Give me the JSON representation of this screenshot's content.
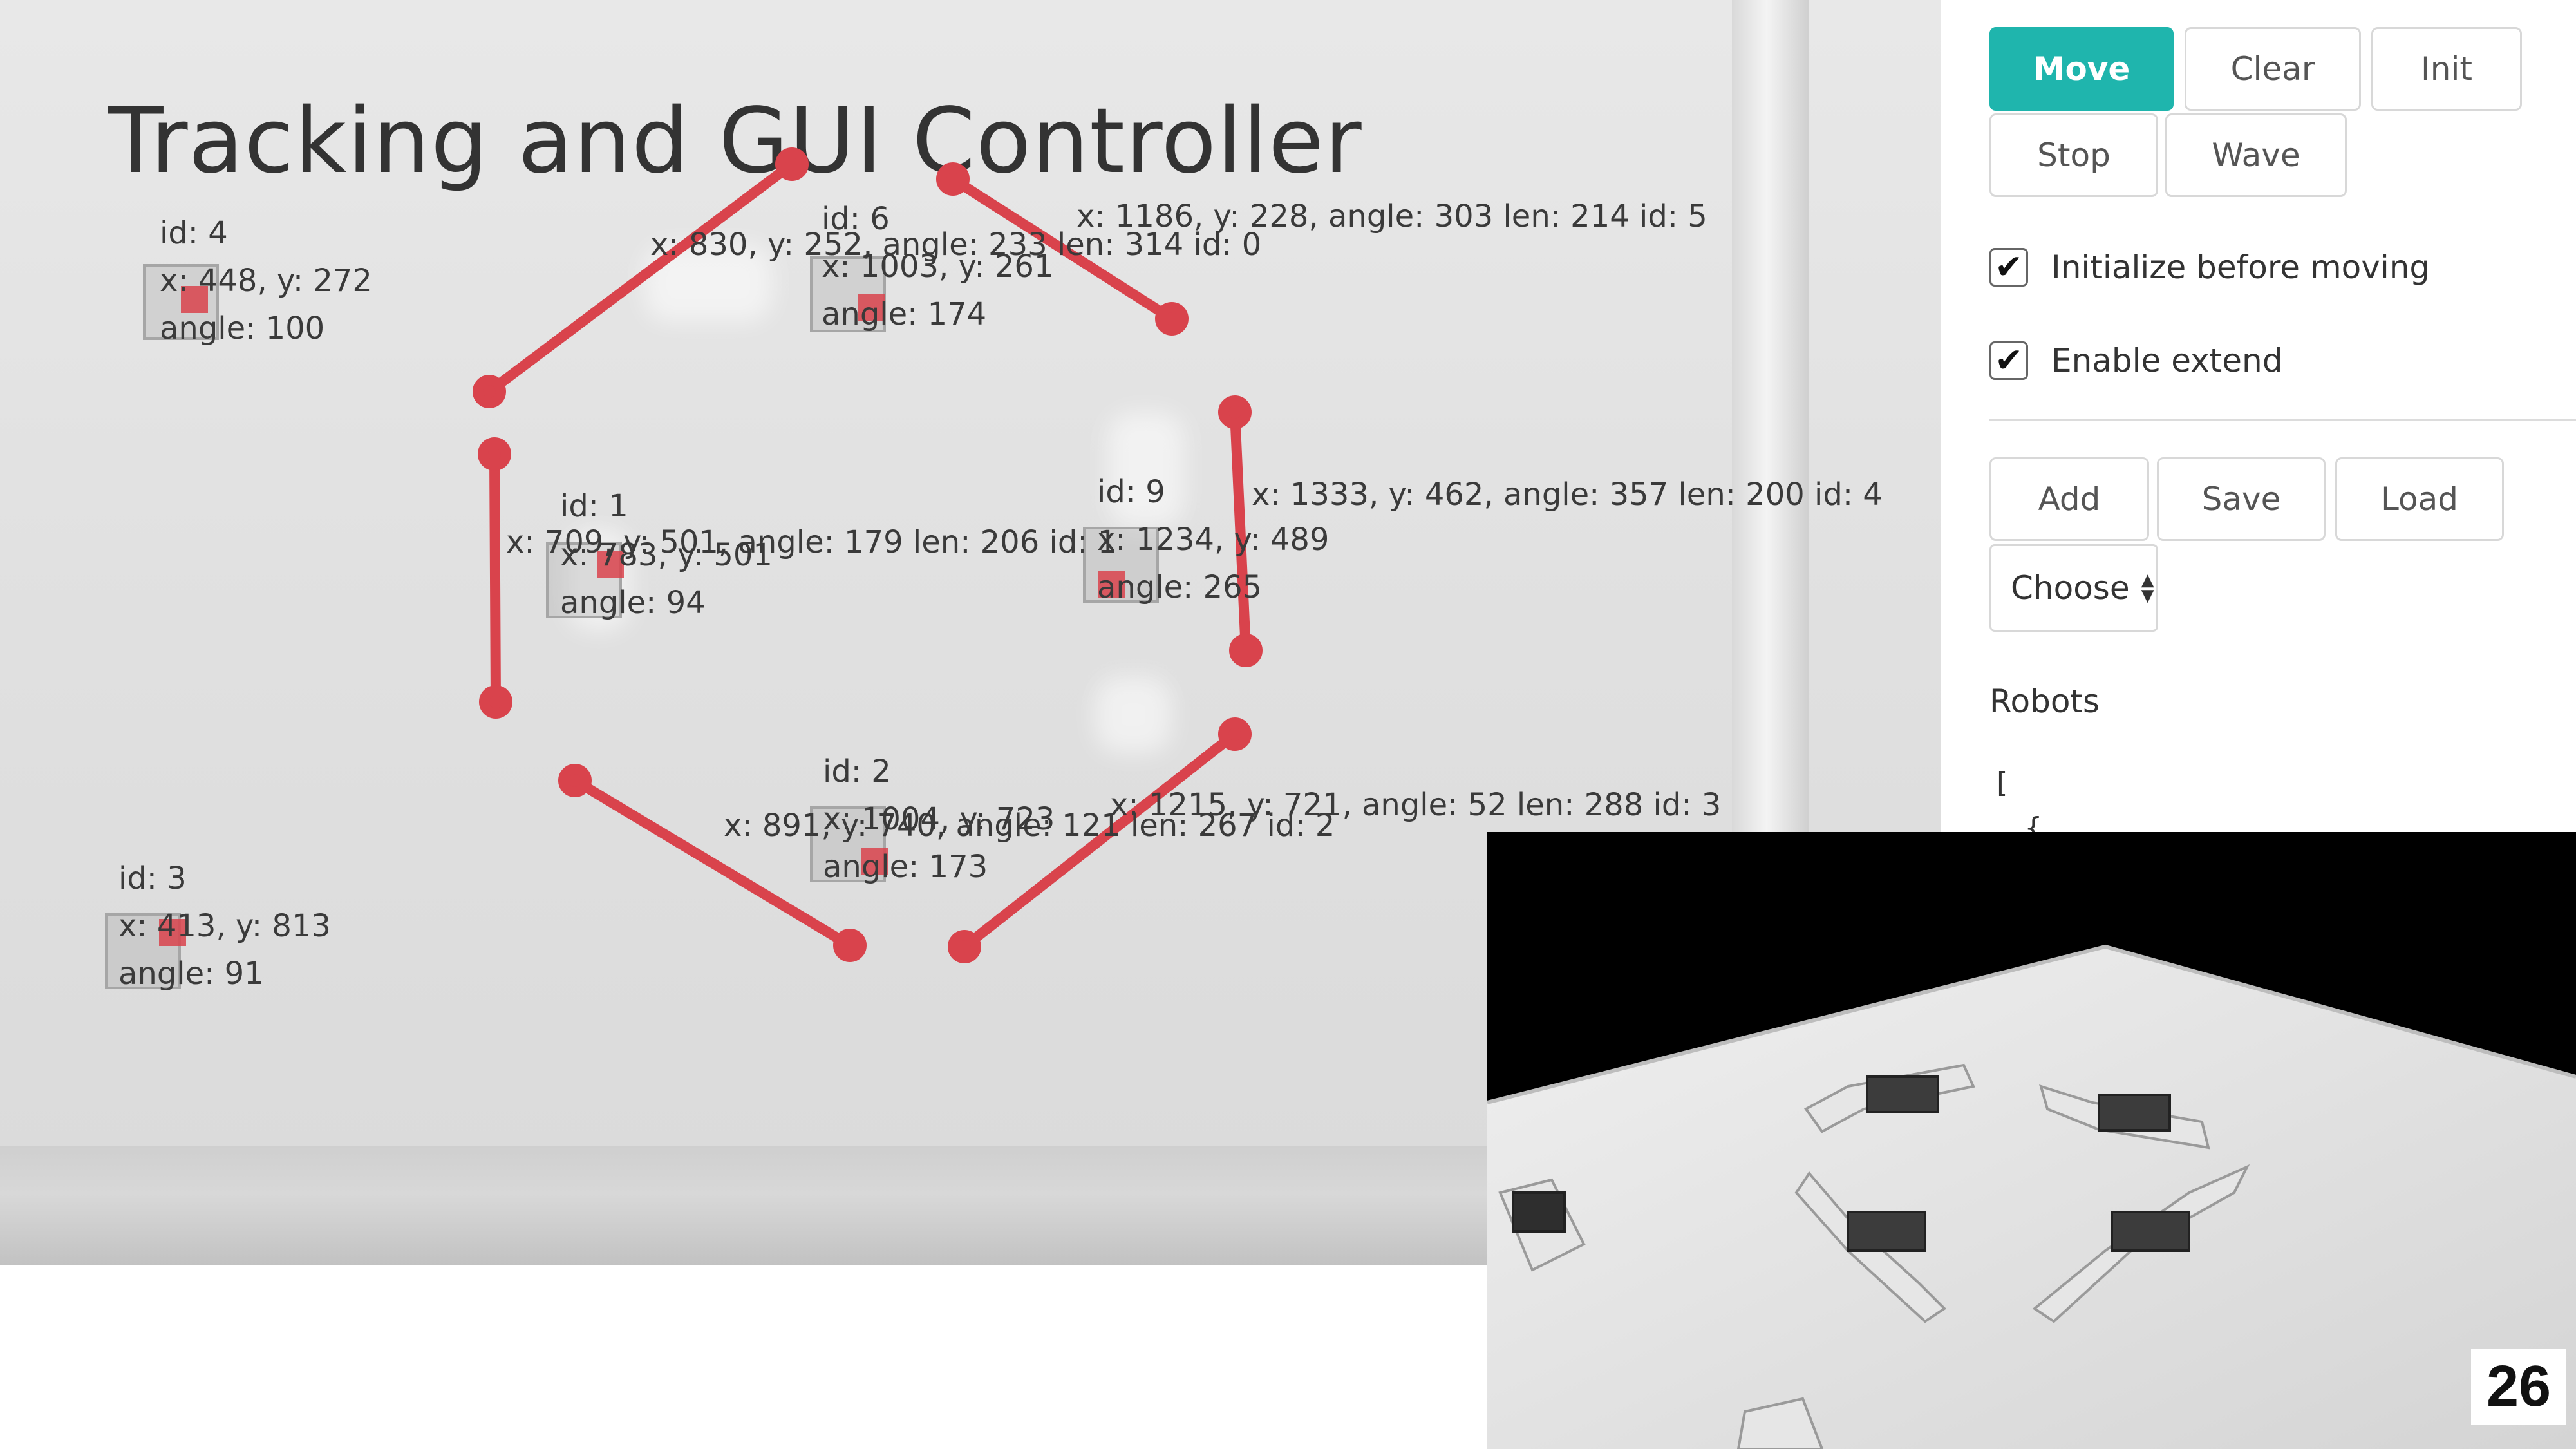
{
  "title": "Tracking and GUI Controller",
  "controls": {
    "move": "Move",
    "clear": "Clear",
    "init": "Init",
    "stop": "Stop",
    "wave": "Wave",
    "add": "Add",
    "save": "Save",
    "load": "Load",
    "choose": "Choose"
  },
  "options": {
    "init_before_moving": {
      "label": "Initialize before moving",
      "checked": true
    },
    "enable_extend": {
      "label": "Enable extend",
      "checked": true
    }
  },
  "robots_section": {
    "heading": "Robots",
    "json_line_1": "[",
    "json_line_2": "{"
  },
  "robot_markers": [
    {
      "id_label": "id: 4",
      "position": "x: 448, y: 272",
      "angle": "angle: 100"
    },
    {
      "id_label": "id: 6",
      "position": "x: 1003, y: 261",
      "angle": "angle: 174"
    },
    {
      "id_label": "id: 1",
      "position": "x: 783, y: 501",
      "angle": "angle: 94"
    },
    {
      "id_label": "id: 9",
      "position": "x: 1234, y: 489",
      "angle": "angle: 265"
    },
    {
      "id_label": "id: 2",
      "position": "x: 1004, y: 723",
      "angle": "angle: 173"
    },
    {
      "id_label": "id: 3",
      "position": "x: 413, y: 813",
      "angle": "angle: 91"
    }
  ],
  "segment_labels": [
    "x: 830, y: 252, angle: 233 len: 314 id: 0",
    "x: 1186, y: 228, angle: 303 len: 214 id: 5",
    "x: 709, y: 501, angle: 179 len: 206 id: 1",
    "x: 1333, y: 462, angle: 357 len: 200 id: 4",
    "x: 891, y: 740, angle: 121 len: 267 id: 2",
    "x: 1215, y: 721, angle: 52 len: 288 id: 3"
  ],
  "slide_number": "26",
  "colors": {
    "accent": "#1fb5ad",
    "segment": "#d9434c",
    "text": "#333333"
  }
}
